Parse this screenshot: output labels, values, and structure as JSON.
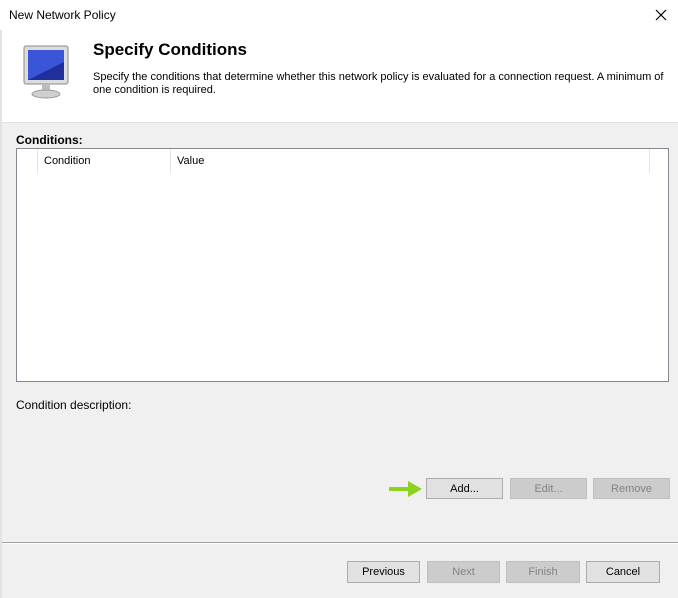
{
  "window": {
    "title": "New Network Policy"
  },
  "header": {
    "title": "Specify Conditions",
    "description": "Specify the conditions that determine whether this network policy is evaluated for a connection request. A minimum of one condition is required."
  },
  "conditions": {
    "label": "Conditions:",
    "columns": [
      "",
      "Condition",
      "Value"
    ],
    "rows": []
  },
  "description_label": "Condition description:",
  "actions": {
    "add": "Add...",
    "edit": "Edit...",
    "remove": "Remove"
  },
  "footer": {
    "previous": "Previous",
    "next": "Next",
    "finish": "Finish",
    "cancel": "Cancel"
  },
  "colors": {
    "arrow": "#8cd21e",
    "disabled_text": "#838383"
  }
}
